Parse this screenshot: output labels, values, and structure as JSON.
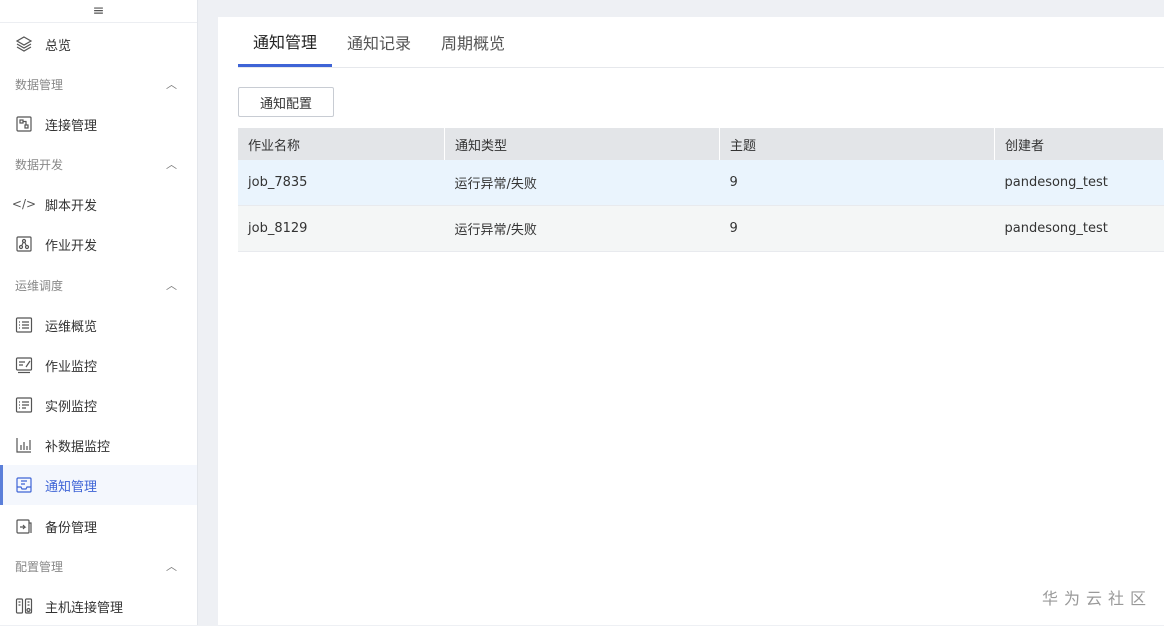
{
  "sidebar": {
    "collapse_icon": "≡",
    "items": [
      {
        "type": "item",
        "label": "总览",
        "icon": "layers-icon"
      },
      {
        "type": "group",
        "label": "数据管理"
      },
      {
        "type": "item",
        "label": "连接管理",
        "icon": "connection-icon"
      },
      {
        "type": "group",
        "label": "数据开发"
      },
      {
        "type": "item",
        "label": "脚本开发",
        "icon": "code-icon"
      },
      {
        "type": "item",
        "label": "作业开发",
        "icon": "workflow-icon"
      },
      {
        "type": "group",
        "label": "运维调度"
      },
      {
        "type": "item",
        "label": "运维概览",
        "icon": "list-icon"
      },
      {
        "type": "item",
        "label": "作业监控",
        "icon": "edit-monitor-icon"
      },
      {
        "type": "item",
        "label": "实例监控",
        "icon": "instance-list-icon"
      },
      {
        "type": "item",
        "label": "补数据监控",
        "icon": "bar-chart-icon"
      },
      {
        "type": "item",
        "label": "通知管理",
        "icon": "inbox-icon",
        "active": true
      },
      {
        "type": "item",
        "label": "备份管理",
        "icon": "backup-icon"
      },
      {
        "type": "group",
        "label": "配置管理"
      },
      {
        "type": "item",
        "label": "主机连接管理",
        "icon": "host-icon"
      }
    ]
  },
  "tabs": [
    {
      "label": "通知管理",
      "active": true
    },
    {
      "label": "通知记录"
    },
    {
      "label": "周期概览"
    }
  ],
  "toolbar": {
    "config_button": "通知配置"
  },
  "table": {
    "headers": [
      "作业名称",
      "通知类型",
      "主题",
      "创建者"
    ],
    "rows": [
      [
        "job_7835",
        "运行异常/失败",
        "9",
        "pandesong_test"
      ],
      [
        "job_8129",
        "运行异常/失败",
        "9",
        "pandesong_test"
      ]
    ]
  },
  "watermark": "华为云社区",
  "colors": {
    "accent": "#3e64d6",
    "background": "#eef0f4",
    "header_bg": "#e3e5e8",
    "row_highlight": "#eaf4fd"
  }
}
